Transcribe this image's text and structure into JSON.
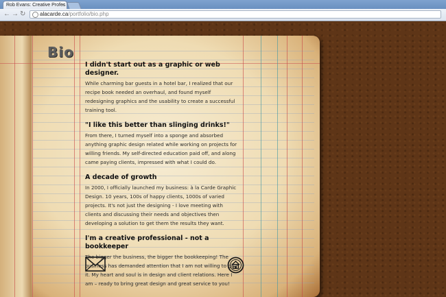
{
  "browser": {
    "tab_title": "Rob Evans: Creative Profes",
    "tab_close": "×",
    "back_icon": "arrow-left-icon",
    "forward_icon": "arrow-right-icon",
    "reload_icon": "reload-icon",
    "url_domain": "alacarde.ca",
    "url_path": "/portfolio/bio.php"
  },
  "page": {
    "title": "Bio",
    "sections": [
      {
        "heading": "I didn't start out as a graphic or web designer.",
        "body": "While charming bar guests in a hotel bar, I realized that our recipe book needed an overhaul, and found myself redesigning graphics and the usability to create a successful training tool."
      },
      {
        "heading": "\"I like this better than slinging drinks!\"",
        "body": "From there, I turned myself into a sponge and absorbed anything graphic design related while working on projects for willing friends. My self-directed education paid off, and along came paying clients, impressed with what I could do."
      },
      {
        "heading": "A decade of growth",
        "body": "In 2000, I officially launched my business: à la Carde Graphic Design. 10 years, 100s of happy clients, 1000s of varied projects. It's not just the designing -  I love meeting with clients and discussing their needs and objectives then developing a solution to get them the results they want."
      },
      {
        "heading": "I'm a creative professional - not a bookkeeper",
        "body": "The bigger the business, the bigger the bookkeeping! The business has demanded attention that I am not willing to give it. My heart and soul is in design and client relations. Here I am – ready to bring great design and great service to you!"
      }
    ],
    "icons": {
      "mail": "envelope-icon",
      "home": "home-icon"
    }
  }
}
